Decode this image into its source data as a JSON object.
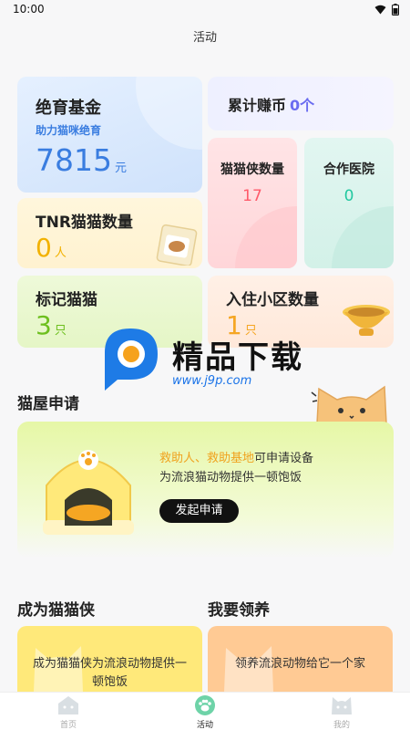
{
  "status": {
    "time": "10:00"
  },
  "page": {
    "title": "活动"
  },
  "stats": {
    "fund": {
      "title": "绝育基金",
      "subtitle": "助力猫咪绝育",
      "value": "7815",
      "unit": "元"
    },
    "coins": {
      "label": "累计赚币",
      "value": "0个"
    },
    "knights": {
      "title": "猫猫侠数量",
      "value": "17"
    },
    "hospitals": {
      "title": "合作医院",
      "value": "0"
    },
    "tnr": {
      "title": "TNR猫猫数量",
      "value": "0",
      "unit": "人"
    },
    "marked": {
      "title": "标记猫猫",
      "value": "3",
      "unit": "只"
    },
    "communities": {
      "title": "入住小区数量",
      "value": "1",
      "unit": "只"
    }
  },
  "shelter": {
    "section_title": "猫屋申请",
    "highlight": "救助人、救助基地",
    "line1_rest": "可申请设备",
    "line2": "为流浪猫动物提供一顿饱饭",
    "button": "发起申请"
  },
  "become": {
    "title": "成为猫猫侠",
    "text": "成为猫猫侠为流浪动物提供一顿饱饭"
  },
  "adopt": {
    "title": "我要领养",
    "text": "领养流浪动物给它一个家"
  },
  "tabs": [
    {
      "label": "首页",
      "icon": "home-icon"
    },
    {
      "label": "活动",
      "icon": "paw-icon"
    },
    {
      "label": "我的",
      "icon": "cat-face-icon"
    }
  ],
  "watermark": {
    "text": "精品下载",
    "url": "www.j9p.com"
  },
  "colors": {
    "fund_value": "#3a7de0",
    "coins_value": "#6a6cf0",
    "knight_value": "#ff5a6a",
    "hospital_value": "#22c8a0",
    "tnr_value": "#f2b100",
    "mark_value": "#6dbf1e",
    "comm_value": "#f5a623"
  }
}
